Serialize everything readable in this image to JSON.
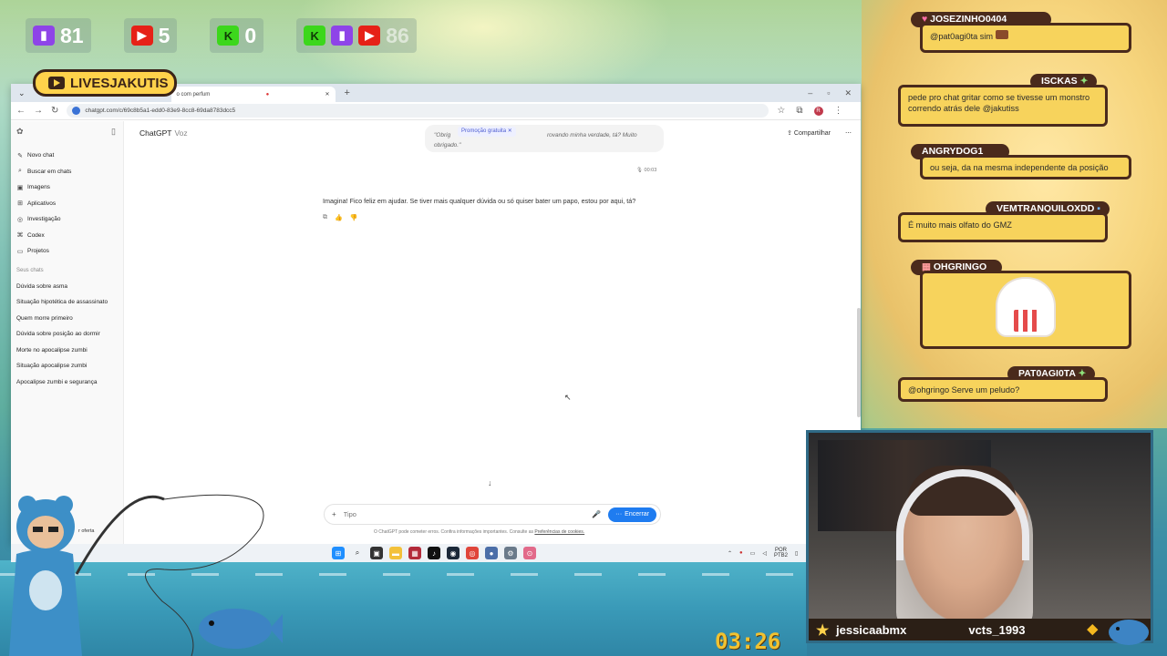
{
  "overlay": {
    "counters": [
      {
        "icon": "twitch-icon",
        "value": "81"
      },
      {
        "icon": "youtube-icon",
        "value": "5"
      },
      {
        "icon": "kick-icon",
        "value": "0"
      },
      {
        "icon": "multi-platform-icon",
        "value": "86"
      }
    ],
    "channel_badge": "LIVESJAKUTIS",
    "timer": "03:26",
    "colors": {
      "twitch": "#8e44e8",
      "youtube": "#e62117",
      "kick": "#3cd71c",
      "chat_bubble": "#f7d35c",
      "chat_border": "#4a2a1c"
    }
  },
  "browser": {
    "tab_title": "o com perfum",
    "url": "chatgpt.com/c/69c8b5a1-edd0-83e9-8cc8-69da8783dcc5"
  },
  "chatgpt": {
    "sidebar": {
      "nav": [
        {
          "icon": "compose-icon",
          "label": "Novo chat"
        },
        {
          "icon": "search-icon",
          "label": "Buscar em chats"
        },
        {
          "icon": "image-icon",
          "label": "Imagens"
        },
        {
          "icon": "apps-icon",
          "label": "Aplicativos"
        },
        {
          "icon": "research-icon",
          "label": "Investigação"
        },
        {
          "icon": "codex-icon",
          "label": "Codex"
        },
        {
          "icon": "folder-icon",
          "label": "Projetos"
        }
      ],
      "section_label": "Seus chats",
      "chats": [
        "Dúvida sobre asma",
        "Situação hipotética de assassinato",
        "Quem morre primeiro",
        "Dúvida sobre posição ao dormir",
        "Morte no apocalipse zumbi",
        "Situação apocalipse zumbi",
        "Apocalipse zumbi e segurança"
      ],
      "bottom_label": "r oferta"
    },
    "header": {
      "title": "ChatGPT",
      "model": "Voz",
      "share_label": "Compartilhar"
    },
    "user_message": {
      "start": "\"Obrig",
      "promo": "Promoção gratuita",
      "rest": "rovando minha verdade, tá? Muito obrigado.\""
    },
    "timestamp": "00:03",
    "assistant_message": "Imagina! Fico feliz em ajudar. Se tiver mais qualquer dúvida ou só quiser bater um papo, estou por aqui, tá?",
    "composer": {
      "placeholder": "Tipo",
      "end_label": "Encerrar"
    },
    "disclaimer": {
      "text": "O ChatGPT pode cometer erros. Confira informações importantes. Consulte as",
      "link": "Preferências de cookies."
    }
  },
  "taskbar": {
    "lang": "POR",
    "layout": "PTB2"
  },
  "chat": [
    {
      "user": "JOSEZINHO0404",
      "message": "@pat0agi0ta sim"
    },
    {
      "user": "ISCKAS",
      "message": "pede pro chat gritar como se tivesse um monstro correndo atrás dele @jakutiss"
    },
    {
      "user": "ANGRYDOG1_",
      "message": "ou seja, da na mesma independente da posição"
    },
    {
      "user": "VEMTRANQUILOXDD",
      "message": "É muito mais olfato do GMZ"
    },
    {
      "user": "OHGRINGO",
      "message": ""
    },
    {
      "user": "PAT0AGI0TA",
      "message": "@ohgringo Serve um  peludo?"
    }
  ],
  "webcam": {
    "left_user": "jessicaabmx",
    "right_user": "vcts_1993"
  }
}
